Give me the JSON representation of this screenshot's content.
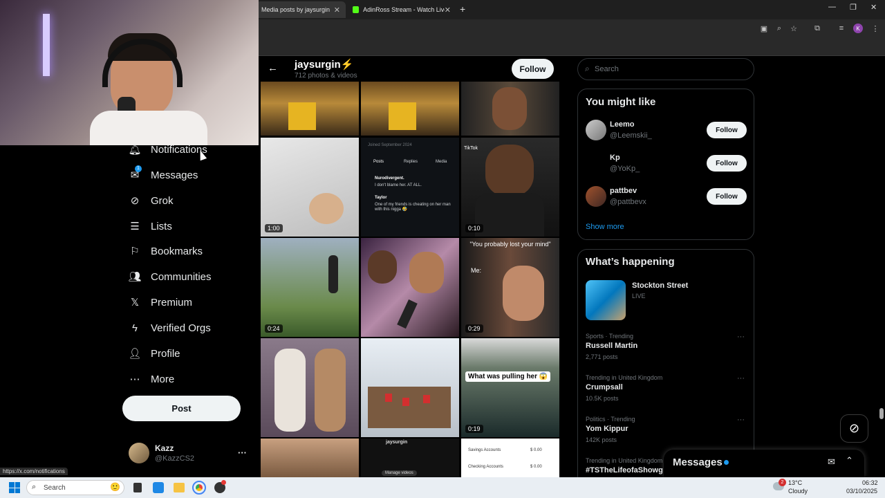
{
  "browser": {
    "tabs": [
      {
        "label": "Media posts by jaysurgin⚡"
      },
      {
        "label": "AdinRoss Stream - Watch Live o"
      }
    ],
    "new_tab": "+",
    "window_controls": {
      "minimize": "—",
      "restore": "❐",
      "close": "✕"
    }
  },
  "sidebar": {
    "items": [
      {
        "label": "Notifications",
        "icon": "bell-icon"
      },
      {
        "label": "Messages",
        "icon": "envelope-icon",
        "badge": "1"
      },
      {
        "label": "Grok",
        "icon": "grok-icon"
      },
      {
        "label": "Lists",
        "icon": "list-icon"
      },
      {
        "label": "Bookmarks",
        "icon": "bookmark-icon"
      },
      {
        "label": "Communities",
        "icon": "people-icon"
      },
      {
        "label": "Premium",
        "icon": "x-logo-icon"
      },
      {
        "label": "Verified Orgs",
        "icon": "lightning-icon"
      },
      {
        "label": "Profile",
        "icon": "person-icon"
      },
      {
        "label": "More",
        "icon": "more-circle-icon"
      }
    ],
    "post_label": "Post",
    "account": {
      "name": "Kazz",
      "handle": "@KazzCS2",
      "more": "···"
    }
  },
  "media": {
    "title": "jaysurgin⚡",
    "subtitle": "712 photos & videos",
    "follow_label": "Follow",
    "durations": [
      "1:00",
      "0:10",
      "0:24",
      "0:29",
      "0:19"
    ],
    "captions": {
      "lost_mind": "\"You probably lost your mind\"",
      "me": "Me:",
      "pulling": "What was pulling her 😱",
      "tiktok": "TikTok",
      "post_tabs": [
        "Posts",
        "Replies",
        "Media"
      ],
      "tweet_user": "Nurodivergent.",
      "tweet_line": "I don't blame her. AT ALL.",
      "tweet_line2": "One of my friends is cheating on her man with this nigga 🤣",
      "taylor": "Taylor",
      "bank_rows": [
        {
          "label": "Savings Accounts",
          "value": "$ 0.00"
        },
        {
          "label": "Checking Accounts",
          "value": "$ 0.00"
        }
      ],
      "manage_videos": "Manage videos",
      "jay_handle": "jaysurgin",
      "join_date": "Joined September 2024"
    }
  },
  "right": {
    "search_placeholder": "Search",
    "you_might_like": "You might like",
    "suggestions": [
      {
        "name": "Leemo",
        "handle": "@Leemskii_",
        "follow": "Follow"
      },
      {
        "name": "Kp",
        "handle": "@YoKp_",
        "follow": "Follow"
      },
      {
        "name": "pattbev",
        "handle": "@pattbevx",
        "follow": "Follow"
      }
    ],
    "show_more": "Show more",
    "whats_happening": "What’s happening",
    "live": {
      "title": "Stockton Street",
      "status": "LIVE"
    },
    "trends": [
      {
        "context": "Sports · Trending",
        "name": "Russell Martin",
        "count": "2,771 posts"
      },
      {
        "context": "Trending in United Kingdom",
        "name": "Crumpsall",
        "count": "10.5K posts"
      },
      {
        "context": "Politics · Trending",
        "name": "Yom Kippur",
        "count": "142K posts"
      },
      {
        "context": "Trending in United Kingdom",
        "name": "#TSTheLifeofaShowg",
        "count": ""
      }
    ],
    "messages_drawer": "Messages"
  },
  "status_url": "https://x.com/notifications",
  "taskbar": {
    "search_placeholder": "Search",
    "weather_temp": "13°C",
    "weather_desc": "Cloudy",
    "weather_badge": "2",
    "time": "06:32",
    "date": "03/10/2025"
  },
  "colors": {
    "accent": "#1d9bf0",
    "bg": "#000000",
    "border": "#2f3336"
  }
}
